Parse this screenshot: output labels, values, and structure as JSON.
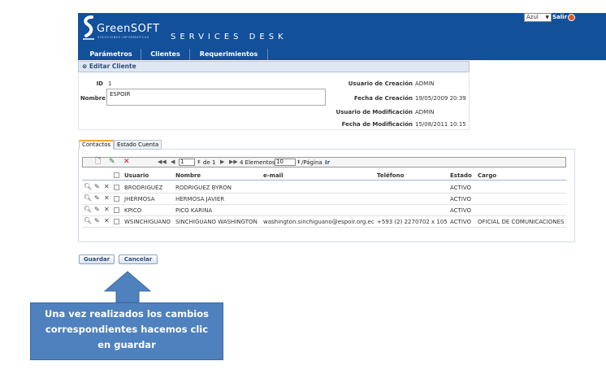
{
  "header": {
    "logo_text": "GreenSOFT",
    "logo_subtitle": "SOLUCIONES INFORMATICAS",
    "app_title": "SERVICES DESK",
    "theme_selected": "Azul",
    "logout_label": "Salir"
  },
  "menu": [
    "Parámetros",
    "Clientes",
    "Requerimientos"
  ],
  "panel_title": "Editar Cliente",
  "form": {
    "id_label": "ID",
    "id_value": "1",
    "nombre_label": "Nombre",
    "nombre_value": "ESPOIR",
    "usuario_creacion_label": "Usuario de Creación",
    "usuario_creacion_value": "ADMIN",
    "fecha_creacion_label": "Fecha de Creación",
    "fecha_creacion_value": "19/05/2009 20:39",
    "usuario_mod_label": "Usuario de Modificación",
    "usuario_mod_value": "ADMIN",
    "fecha_mod_label": "Fecha de Modificación",
    "fecha_mod_value": "15/08/2011 10:15"
  },
  "tabs": [
    "Contactos",
    "Estado Cuenta"
  ],
  "pager": {
    "page": "1",
    "of_label": "de 1",
    "count_label": "4 Elementos",
    "per_page": "10",
    "per_page_label": "/Página",
    "go_label": "Ir"
  },
  "table": {
    "columns": [
      "Usuario",
      "Nombre",
      "e-mail",
      "Teléfono",
      "Estado",
      "Cargo"
    ],
    "rows": [
      {
        "usuario": "BRODRIGUEZ",
        "nombre": "RODRIGUEZ BYRON",
        "email": "",
        "telefono": "",
        "estado": "ACTIVO",
        "cargo": ""
      },
      {
        "usuario": "JHERMOSA",
        "nombre": "HERMOSA JAVIER",
        "email": "",
        "telefono": "",
        "estado": "ACTIVO",
        "cargo": ""
      },
      {
        "usuario": "KPICO",
        "nombre": "PICO KARINA",
        "email": "",
        "telefono": "",
        "estado": "ACTIVO",
        "cargo": ""
      },
      {
        "usuario": "WSINCHIGUANO",
        "nombre": "SINCHIGUANO WASHINGTON",
        "email": "washington.sinchiguano@espoir.org.ec",
        "telefono": "+593 (2) 2270702 x 105",
        "estado": "ACTIVO",
        "cargo": "OFICIAL DE COMUNICACIONES"
      }
    ]
  },
  "buttons": {
    "guardar": "Guardar",
    "cancelar": "Cancelar"
  },
  "callout": {
    "line1": "Una vez realizados los cambios",
    "line2": "correspondientes hacemos clic",
    "line3": "en guardar"
  },
  "colors": {
    "header_bg": "#12509a",
    "callout_bg": "#4e81bd",
    "tab_accent": "#f2a933"
  }
}
